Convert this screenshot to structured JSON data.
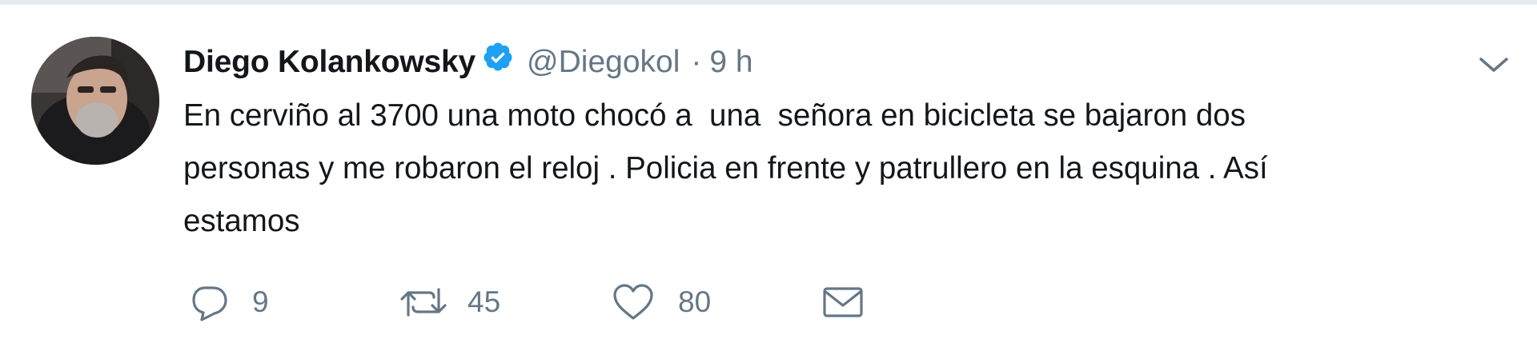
{
  "tweet": {
    "author": {
      "display_name": "Diego Kolankowsky",
      "verified": true,
      "handle": "@Diegokol"
    },
    "separator": "·",
    "time": "9 h",
    "text_lines": [
      "En cerviño al 3700 una moto chocó a  una  señora en bicicleta se bajaron dos",
      "personas y me robaron el reloj . Policia en frente y patrullero en la esquina . Así",
      "estamos"
    ],
    "actions": {
      "reply": {
        "icon": "reply-icon",
        "count": "9"
      },
      "retweet": {
        "icon": "retweet-icon",
        "count": "45"
      },
      "like": {
        "icon": "heart-icon",
        "count": "80"
      },
      "message": {
        "icon": "envelope-icon"
      }
    },
    "menu_icon": "chevron-down-icon"
  },
  "colors": {
    "text": "#14171a",
    "secondary": "#657786",
    "verified": "#1da1f2",
    "border": "#e6ecf0"
  }
}
